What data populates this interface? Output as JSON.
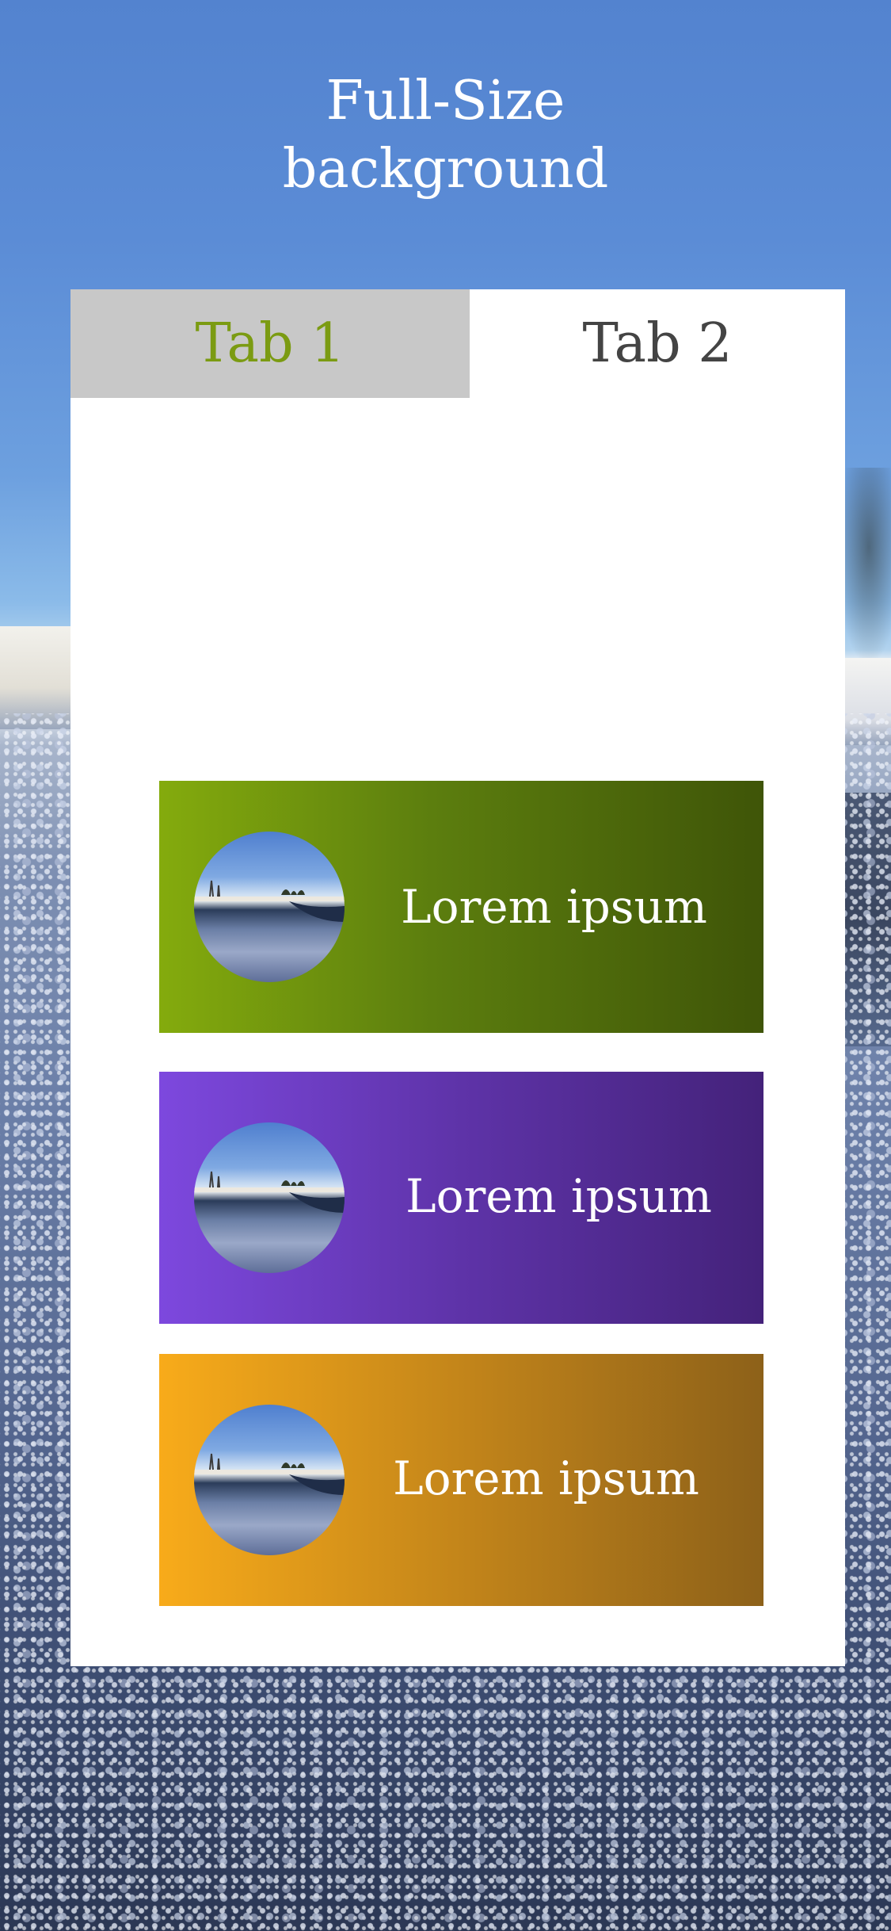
{
  "header": {
    "title_line1": "Full-Size",
    "title_line2": "background"
  },
  "tabs": [
    {
      "label": "Tab 1",
      "active": true
    },
    {
      "label": "Tab 2",
      "active": false
    }
  ],
  "items": [
    {
      "label": "Lorem ipsum",
      "gradient": [
        "#84ab0d",
        "#3f5508"
      ]
    },
    {
      "label": "Lorem ipsum",
      "gradient": [
        "#7d48de",
        "#44227a"
      ]
    },
    {
      "label": "Lorem ipsum",
      "gradient": [
        "#f8ab1a",
        "#8d6119"
      ]
    }
  ],
  "colors": {
    "active_tab_text": "#7b9b12",
    "active_tab_bg": "#c8c8c8",
    "inactive_tab_text": "#444444",
    "card_bg": "#ffffff"
  }
}
